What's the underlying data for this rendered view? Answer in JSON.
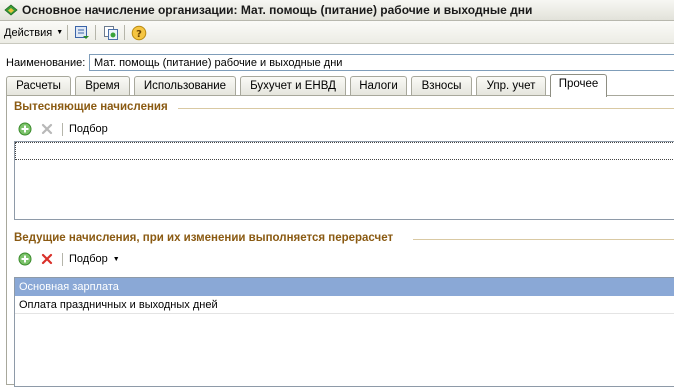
{
  "window": {
    "title": "Основное начисление организации: Мат. помощь  (питание) рабочие и выходные дни"
  },
  "toolbar": {
    "actions_label": "Действия"
  },
  "form": {
    "name_label": "Наименование:",
    "name_value": "Мат. помощь  (питание) рабочие и выходные дни"
  },
  "tabs": [
    {
      "label": "Расчеты"
    },
    {
      "label": "Время"
    },
    {
      "label": "Использование"
    },
    {
      "label": "Бухучет и ЕНВД"
    },
    {
      "label": "Налоги"
    },
    {
      "label": "Взносы"
    },
    {
      "label": "Упр. учет"
    },
    {
      "label": "Прочее"
    }
  ],
  "active_tab": 7,
  "section_displacing": {
    "title": "Вытесняющие начисления",
    "select_label": "Подбор",
    "rows": []
  },
  "section_leading": {
    "title": "Ведущие начисления, при их изменении выполняется перерасчет",
    "select_label": "Подбор",
    "rows": [
      {
        "label": "Основная зарплата",
        "selected": true
      },
      {
        "label": "Оплата праздничных и выходных дней",
        "selected": false
      }
    ]
  },
  "colors": {
    "section_title": "#8a5a12",
    "selection": "#8aa8d6"
  }
}
